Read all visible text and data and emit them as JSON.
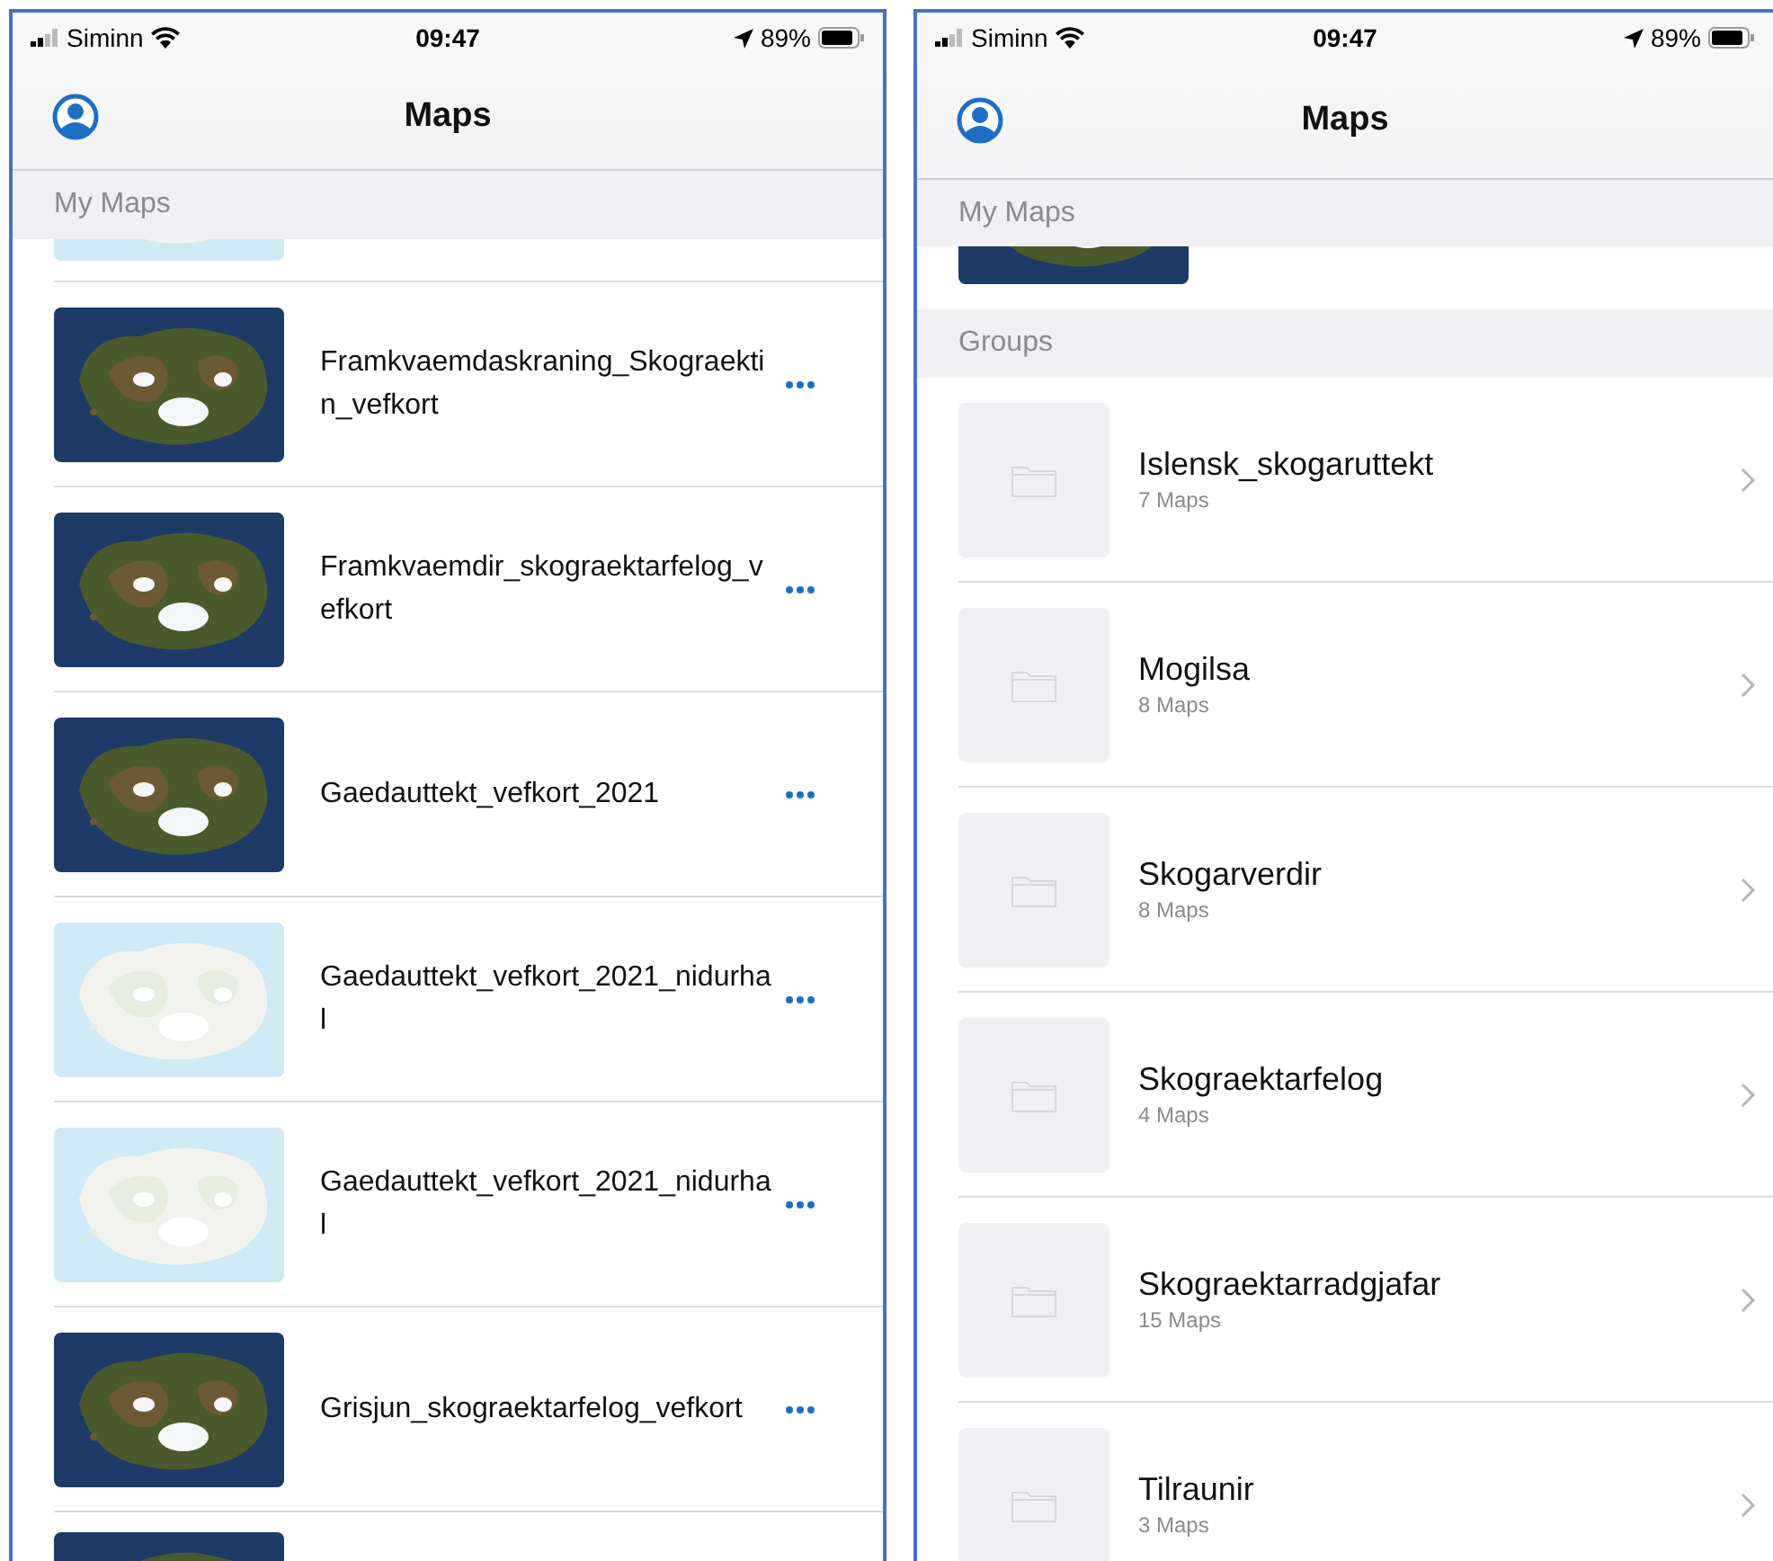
{
  "screens": [
    {
      "status_bar": {
        "carrier": "Siminn",
        "time": "09:47",
        "battery": "89%"
      },
      "title": "Maps",
      "my_maps": {
        "header": "My Maps",
        "top_cut_thumbnail": {
          "kind": "picture",
          "light_basemap": true
        },
        "items": [
          {
            "title": "Framkvaemdaskraning_Skograektin_vefkort",
            "light_basemap": false
          },
          {
            "title": "Framkvaemdir_skograektarfelog_vefkort",
            "light_basemap": false
          },
          {
            "title": "Gaedauttekt_vefkort_2021",
            "light_basemap": false
          },
          {
            "title": "Gaedauttekt_vefkort_2021_nidurhal",
            "light_basemap": true
          },
          {
            "title": "Gaedauttekt_vefkort_2021_nidurhal",
            "light_basemap": true
          },
          {
            "title": "Grisjun_skograektarfelog_vefkort",
            "light_basemap": false
          }
        ],
        "bottom_cut_thumbnail": {
          "kind": "picture",
          "light_basemap": false
        }
      }
    },
    {
      "status_bar": {
        "carrier": "Siminn",
        "time": "09:47",
        "battery": "89%"
      },
      "title": "Maps",
      "my_maps": {
        "header": "My Maps",
        "top_cut_thumbnail": {
          "kind": "picture",
          "light_basemap": false
        }
      },
      "groups": {
        "header": "Groups",
        "items": [
          {
            "name": "Islensk_skogaruttekt",
            "count": "7 Maps"
          },
          {
            "name": "Mogilsa",
            "count": "8 Maps"
          },
          {
            "name": "Skogarverdir",
            "count": "8 Maps"
          },
          {
            "name": "Skograektarfelog",
            "count": "4 Maps"
          },
          {
            "name": "Skograektarradgjafar",
            "count": "15 Maps"
          },
          {
            "name": "Tilraunir",
            "count": "3 Maps"
          }
        ]
      }
    }
  ]
}
